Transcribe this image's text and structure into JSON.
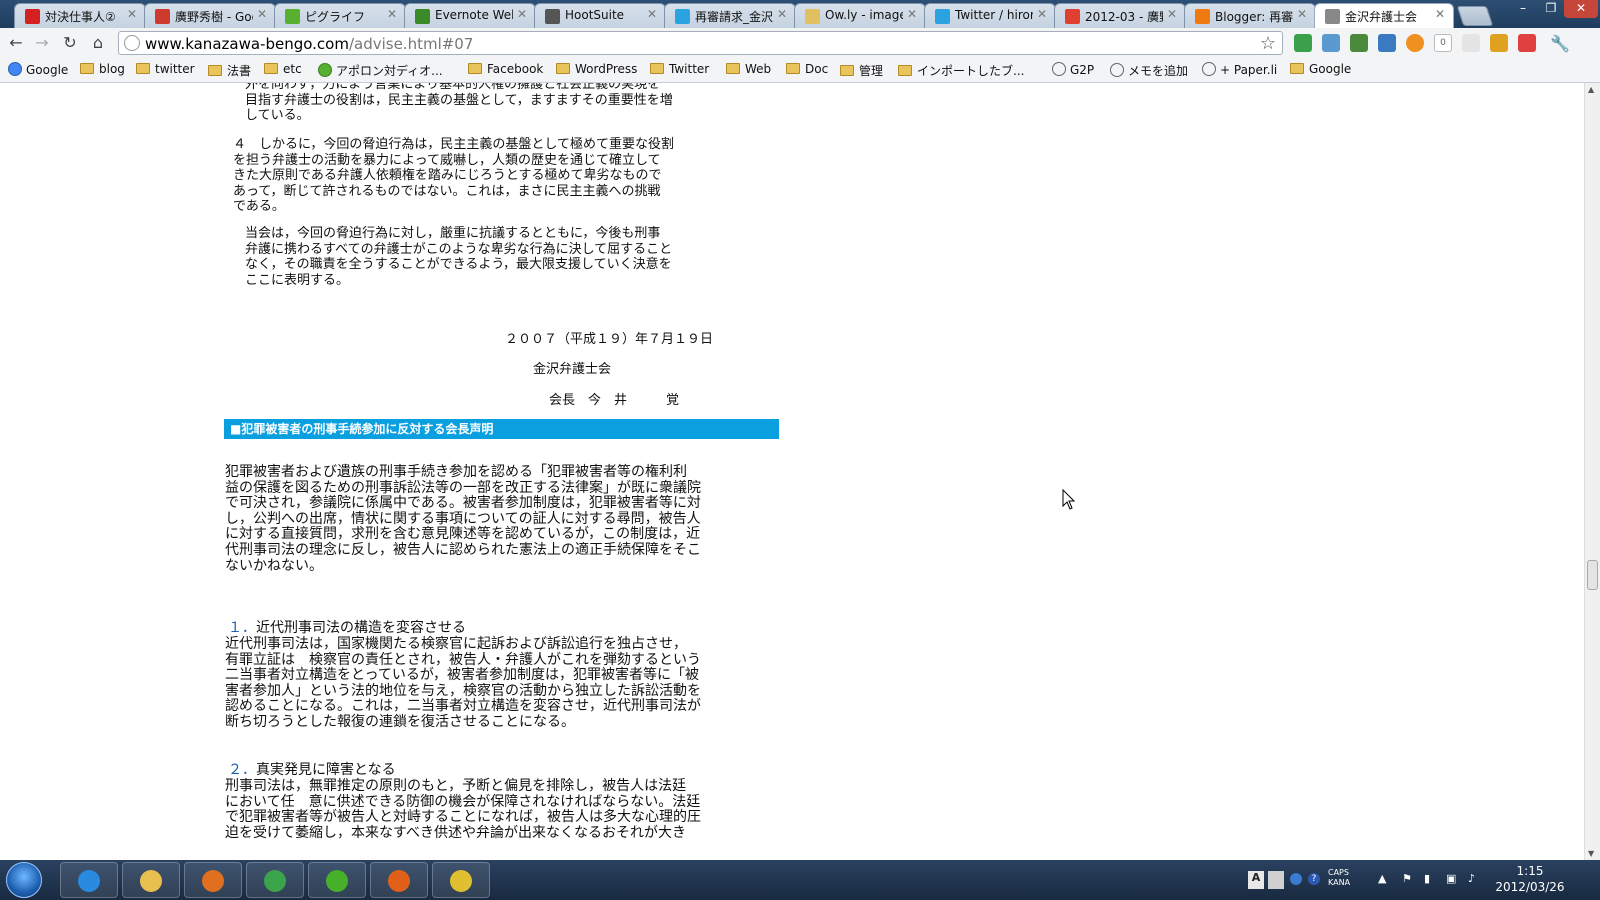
{
  "tabs": [
    {
      "title": "対決仕事人②",
      "fav_color": "#d42020"
    },
    {
      "title": "廣野秀樹 - Goo",
      "fav_color": "#cc3b2c"
    },
    {
      "title": "ピグライフ",
      "fav_color": "#58b030"
    },
    {
      "title": "Evernote Web",
      "fav_color": "#3a8a2a"
    },
    {
      "title": "HootSuite",
      "fav_color": "#555555"
    },
    {
      "title": "再審請求_金沢",
      "fav_color": "#2aa3e0"
    },
    {
      "title": "Ow.ly - image",
      "fav_color": "#e0c060"
    },
    {
      "title": "Twitter / hiror",
      "fav_color": "#2aa3e0"
    },
    {
      "title": "2012-03 - 廣野",
      "fav_color": "#e04030"
    },
    {
      "title": "Blogger: 再審",
      "fav_color": "#f07a10"
    },
    {
      "title": "金沢弁護士会",
      "fav_color": "#888888",
      "active": true
    }
  ],
  "window_controls": {
    "minimize": "–",
    "maximize": "❐",
    "close": "✕"
  },
  "toolbar": {
    "back": "←",
    "forward": "→",
    "reload": "↻",
    "home": "⌂",
    "url_host": "www.kanazawa-bengo.com",
    "url_path": "/advise.html#07",
    "star": "☆",
    "ext_badge": "0"
  },
  "bookmarks": [
    {
      "label": "Google",
      "type": "google"
    },
    {
      "label": "blog",
      "type": "folder"
    },
    {
      "label": "twitter",
      "type": "folder"
    },
    {
      "label": "法書",
      "type": "folder"
    },
    {
      "label": "etc",
      "type": "folder"
    },
    {
      "label": "アポロン対ディオ...",
      "type": "pig"
    },
    {
      "label": "Facebook",
      "type": "folder"
    },
    {
      "label": "WordPress",
      "type": "folder"
    },
    {
      "label": "Twitter",
      "type": "folder"
    },
    {
      "label": "Web",
      "type": "folder"
    },
    {
      "label": "Doc",
      "type": "folder"
    },
    {
      "label": "管理",
      "type": "folder"
    },
    {
      "label": "インポートしたブ...",
      "type": "folder"
    },
    {
      "label": "G2P",
      "type": "globe"
    },
    {
      "label": "メモを追加",
      "type": "globe"
    },
    {
      "label": "+ Paper.li",
      "type": "globe"
    },
    {
      "label": "Google",
      "type": "folder"
    }
  ],
  "page": {
    "para_top": [
      "外を向わず，力によう言業により基本的人権の擁護と社会正義の実現を",
      "目指す弁護士の役割は，民主主義の基盤として，ますますその重要性を増",
      "している。"
    ],
    "para_4": [
      "４　しかるに，今回の脅迫行為は，民主主義の基盤として極めて重要な役割",
      "を担う弁護士の活動を暴力によって威嚇し，人類の歴史を通じて確立して",
      "きた大原則である弁護人依頼権を踏みにじろうとする極めて卑劣なもので",
      "あって，断じて許されるものではない。これは，まさに民主主義への挑戦",
      "である。"
    ],
    "para_resolve": [
      "当会は，今回の脅迫行為に対し，厳重に抗議するとともに，今後も刑事",
      "弁護に携わるすべての弁護士がこのような卑劣な行為に決して屈すること",
      "なく，その職責を全うすることができるよう，最大限支援していく決意を",
      "ここに表明する。"
    ],
    "date": "２００７（平成１９）年７月１９日",
    "org": "金沢弁護士会",
    "president": "会長　今　井　　　覚",
    "heading": "■犯罪被害者の刑事手続参加に反対する会長声明",
    "intro": [
      "犯罪被害者および遺族の刑事手続き参加を認める「犯罪被害者等の権利利",
      "益の保護を図るための刑事訴訟法等の一部を改正する法律案」が既に衆議院",
      "で可決され，参議院に係属中である。被害者参加制度は，犯罪被害者等に対",
      "し，公判への出席，情状に関する事項についての証人に対する尋問，被告人",
      "に対する直接質問，求刑を含む意見陳述等を認めているが，この制度は，近",
      "代刑事司法の理念に反し，被告人に認められた憲法上の適正手続保障をそこ",
      "ないかねない。"
    ],
    "sec1_num": "１．",
    "sec1_title": "近代刑事司法の構造を変容させる",
    "sec1_body": [
      "近代刑事司法は，国家機関たる検察官に起訴および訴訟追行を独占させ，",
      "有罪立証は　検察官の責任とされ，被告人・弁護人がこれを弾劾するという",
      "二当事者対立構造をとっているが，被害者参加制度は，犯罪被害者等に「被",
      "害者参加人」という法的地位を与え，検察官の活動から独立した訴訟活動を",
      "認めることになる。これは，二当事者対立構造を変容させ，近代刑事司法が",
      "断ち切ろうとした報復の連鎖を復活させることになる。"
    ],
    "sec2_num": "２．",
    "sec2_title": "真実発見に障害となる",
    "sec2_body": [
      "刑事司法は，無罪推定の原則のもと，予断と偏見を排除し，被告人は法廷",
      "において任　意に供述できる防御の機会が保障されなければならない。法廷",
      "で犯罪被害者等が被告人と対峙することになれば，被告人は多大な心理的圧",
      "迫を受けて萎縮し，本来なすべき供述や弁論が出来なくなるおそれが大き"
    ]
  },
  "taskbar": {
    "apps": [
      {
        "name": "ie",
        "color": "#2a8ae0"
      },
      {
        "name": "explorer",
        "color": "#e8c050"
      },
      {
        "name": "media",
        "color": "#e07020"
      },
      {
        "name": "chrome",
        "color": "#3ba34a"
      },
      {
        "name": "pig",
        "color": "#46b02a"
      },
      {
        "name": "firefox",
        "color": "#e0601a"
      },
      {
        "name": "notes",
        "color": "#e0c030"
      }
    ],
    "tray_caps": "CAPS",
    "tray_kana": "KANA",
    "clock_time": "1:15",
    "clock_date": "2012/03/26"
  }
}
